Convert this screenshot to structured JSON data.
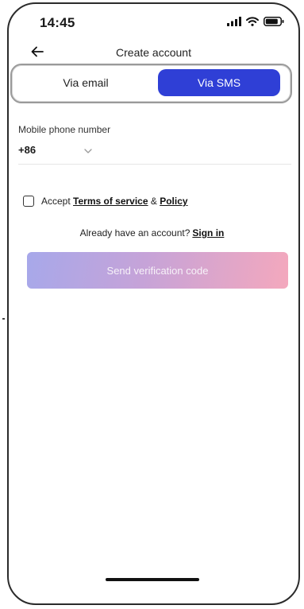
{
  "status_bar": {
    "time": "14:45"
  },
  "nav": {
    "title": "Create account"
  },
  "tabs": [
    {
      "label": "Via email",
      "selected": false
    },
    {
      "label": "Via SMS",
      "selected": true
    }
  ],
  "form": {
    "phone_label": "Mobile phone number",
    "country_code": "+86",
    "phone_value": ""
  },
  "terms": {
    "prefix": "Accept ",
    "terms_link": "Terms of service",
    "joiner": " & ",
    "policy_link": "Policy",
    "checked": false
  },
  "signin": {
    "text": "Already have an account?",
    "link": "Sign in"
  },
  "primary_button": {
    "label": "Send verification code"
  },
  "colors": {
    "accent": "#2f3fd6",
    "gradient_start": "#a7a8ea",
    "gradient_end": "#f4a8bd"
  }
}
